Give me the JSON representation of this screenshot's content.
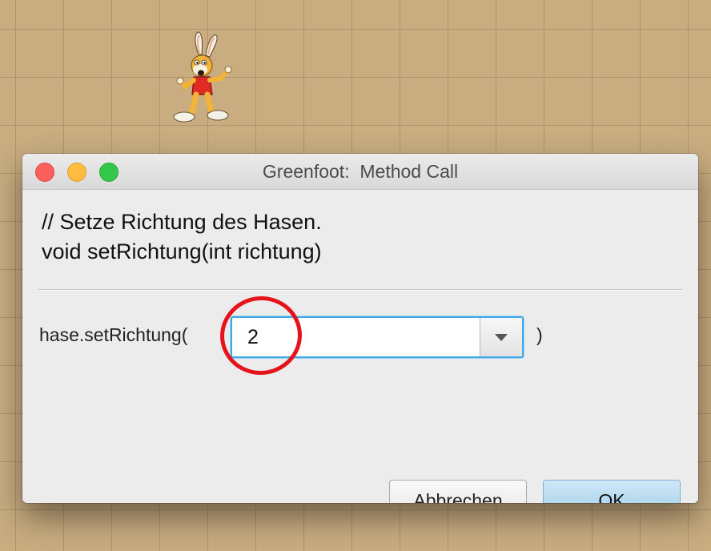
{
  "window": {
    "title": "Greenfoot:  Method Call"
  },
  "dialog": {
    "comment": "// Setze Richtung des Hasen.",
    "signature": "void setRichtung(int richtung)",
    "call_prefix": "hase.setRichtung(",
    "call_suffix": ")",
    "argument": {
      "value": "2"
    },
    "buttons": {
      "cancel_label": "Abbrechen",
      "ok_label": "OK"
    }
  },
  "colors": {
    "world_background": "#f2d39a",
    "focus_ring": "#3fa7e6",
    "highlight_ring": "#e5141b",
    "ok_button": "#b5daf0"
  },
  "icons": {
    "actor": "rabbit-actor-icon",
    "dropdown": "chevron-down-icon"
  }
}
